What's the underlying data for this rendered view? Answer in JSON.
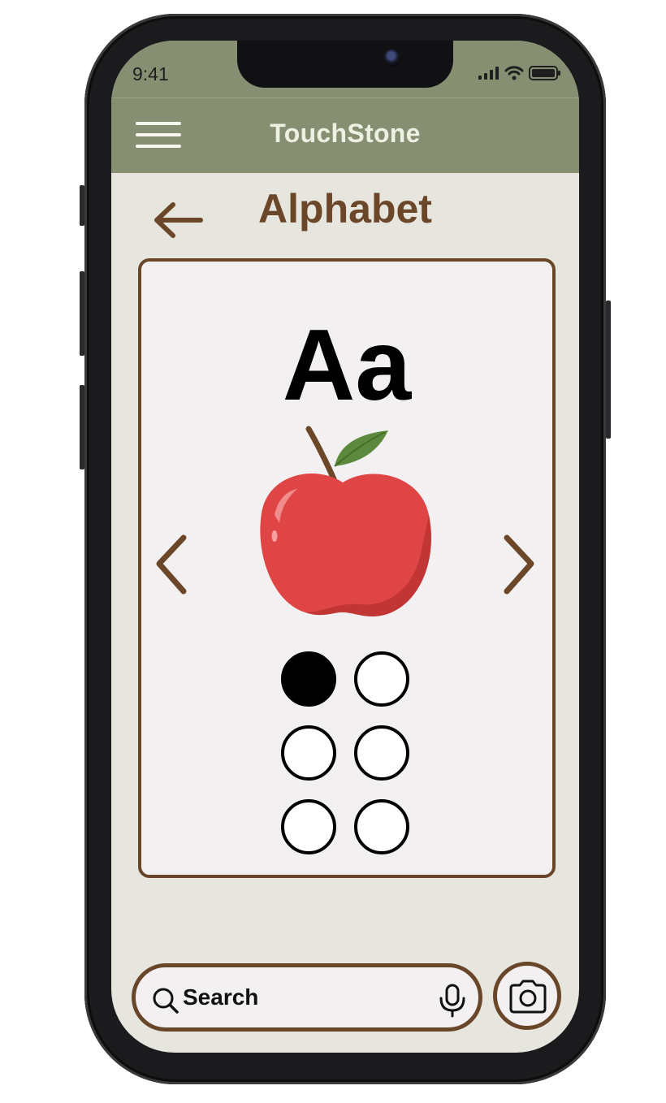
{
  "status_bar": {
    "time": "9:41",
    "icons": [
      "signal-icon",
      "wifi-icon",
      "battery-icon"
    ]
  },
  "header": {
    "app_title": "TouchStone",
    "menu_icon": "hamburger-menu-icon",
    "background_color": "#868f71"
  },
  "page": {
    "title": "Alphabet",
    "back_icon": "back-arrow-icon"
  },
  "card": {
    "letter": "Aa",
    "image": "apple-illustration",
    "prev_icon": "chevron-left-icon",
    "next_icon": "chevron-right-icon",
    "braille_cell": {
      "dots": [
        {
          "number": 1,
          "raised": true
        },
        {
          "number": 4,
          "raised": false
        },
        {
          "number": 2,
          "raised": false
        },
        {
          "number": 5,
          "raised": false
        },
        {
          "number": 3,
          "raised": false
        },
        {
          "number": 6,
          "raised": false
        }
      ]
    }
  },
  "search": {
    "placeholder": "Search",
    "value": "",
    "search_icon": "search-icon",
    "mic_icon": "microphone-icon"
  },
  "camera_button": {
    "icon": "camera-icon"
  },
  "colors": {
    "accent_brown": "#6a4629",
    "header_green": "#868f71",
    "screen_background": "#e6e5de",
    "card_background": "#f2f0f1"
  }
}
